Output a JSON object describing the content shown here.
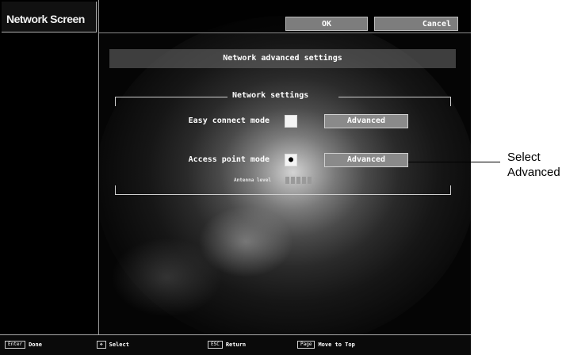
{
  "window": {
    "title": "Network Screen"
  },
  "toolbar": {
    "ok_label": "OK",
    "cancel_label": "Cancel"
  },
  "header": {
    "title": "Network advanced settings"
  },
  "network_group": {
    "title": "Network settings",
    "easy_connect": {
      "label": "Easy connect mode",
      "checked": false,
      "advanced_label": "Advanced"
    },
    "access_point": {
      "label": "Access point mode",
      "checked": true,
      "advanced_label": "Advanced"
    },
    "antenna": {
      "label": "Antenna level"
    }
  },
  "footer": {
    "items": [
      {
        "key": "Enter",
        "label": "Done"
      },
      {
        "key": "✥",
        "label": "Select"
      },
      {
        "key": "ESC",
        "label": "Return"
      },
      {
        "key": "Page",
        "label": "Move to Top"
      }
    ]
  },
  "callout": {
    "text": "Select Advanced"
  }
}
